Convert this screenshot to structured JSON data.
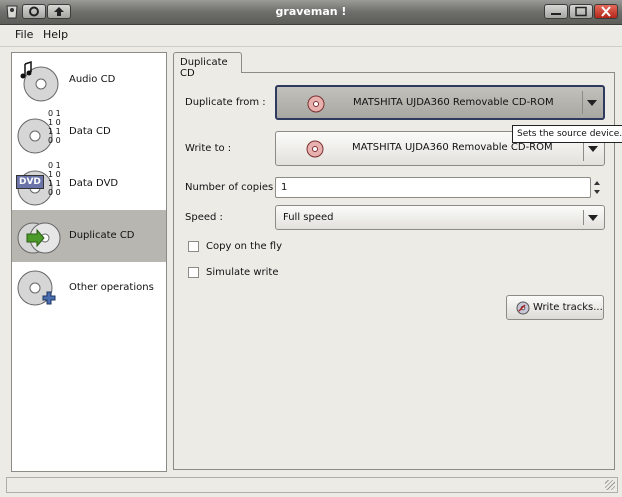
{
  "window": {
    "title": "graveman !"
  },
  "menu": {
    "file": "File",
    "help": "Help"
  },
  "sidebar": {
    "items": [
      {
        "label": "Audio CD",
        "icon": "audio-cd-icon"
      },
      {
        "label": "Data CD",
        "icon": "data-cd-icon",
        "digits": [
          "0 1",
          "1 0",
          "1 1",
          "0 0"
        ]
      },
      {
        "label": "Data DVD",
        "icon": "data-dvd-icon",
        "badge": "DVD"
      },
      {
        "label": "Duplicate CD",
        "icon": "duplicate-cd-icon",
        "selected": true
      },
      {
        "label": "Other operations",
        "icon": "other-operations-icon"
      }
    ]
  },
  "tabs": [
    {
      "label": "Duplicate CD"
    }
  ],
  "form": {
    "duplicate_from": {
      "label": "Duplicate from :",
      "value": "MATSHITA UJDA360 Removable CD-ROM"
    },
    "write_to": {
      "label": "Write to :",
      "value": "MATSHITA UJDA360 Removable CD-ROM"
    },
    "copies": {
      "label": "Number of copies :",
      "value": "1"
    },
    "speed": {
      "label": "Speed :",
      "value": "Full speed"
    },
    "copy_on_fly": {
      "label": "Copy on the fly",
      "checked": false
    },
    "simulate": {
      "label": "Simulate write",
      "checked": false
    },
    "write_tracks": {
      "label": "Write tracks..."
    }
  },
  "tooltip": {
    "text": "Sets the source device."
  },
  "colors": {
    "selected_bg": "#b7b6b1",
    "focus_border": "#2e3a5e",
    "window_bg": "#ecebe6"
  }
}
